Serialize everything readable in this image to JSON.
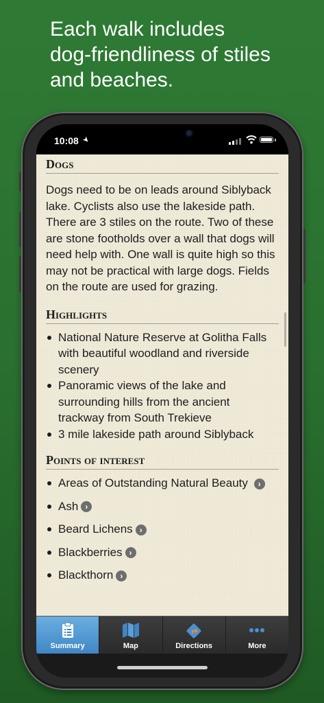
{
  "promo": {
    "line1": "Each walk includes",
    "line2": "dog-friendliness of stiles",
    "line3": "and beaches."
  },
  "status_bar": {
    "time": "10:08"
  },
  "dogs": {
    "heading": "Dogs",
    "text": "Dogs need to be on leads around Siblyback lake. Cyclists also use the lakeside path. There are 3 stiles on the route. Two of these are stone footholds over a wall that dogs will need help with. One wall is quite high so this may not be practical with large dogs. Fields on the route are used for grazing."
  },
  "highlights": {
    "heading": "Highlights",
    "items": [
      "National Nature Reserve at Golitha Falls with beautiful woodland and riverside scenery",
      "Panoramic views of the lake and surrounding hills from the ancient trackway from South Trekieve",
      "3 mile lakeside path around Siblyback"
    ]
  },
  "points_of_interest": {
    "heading": "Points of interest",
    "items": [
      "Areas of Outstanding Natural Beauty",
      "Ash",
      "Beard Lichens",
      "Blackberries",
      "Blackthorn"
    ]
  },
  "tabs": [
    {
      "label": "Summary",
      "icon": "clipboard-icon",
      "active": true
    },
    {
      "label": "Map",
      "icon": "map-icon",
      "active": false
    },
    {
      "label": "Directions",
      "icon": "directions-icon",
      "active": false
    },
    {
      "label": "More",
      "icon": "more-icon",
      "active": false
    }
  ],
  "colors": {
    "background": "#2a7030",
    "paper": "#f1ebd9",
    "tab_active": "#4a90d0",
    "tab_bar": "#333333"
  }
}
